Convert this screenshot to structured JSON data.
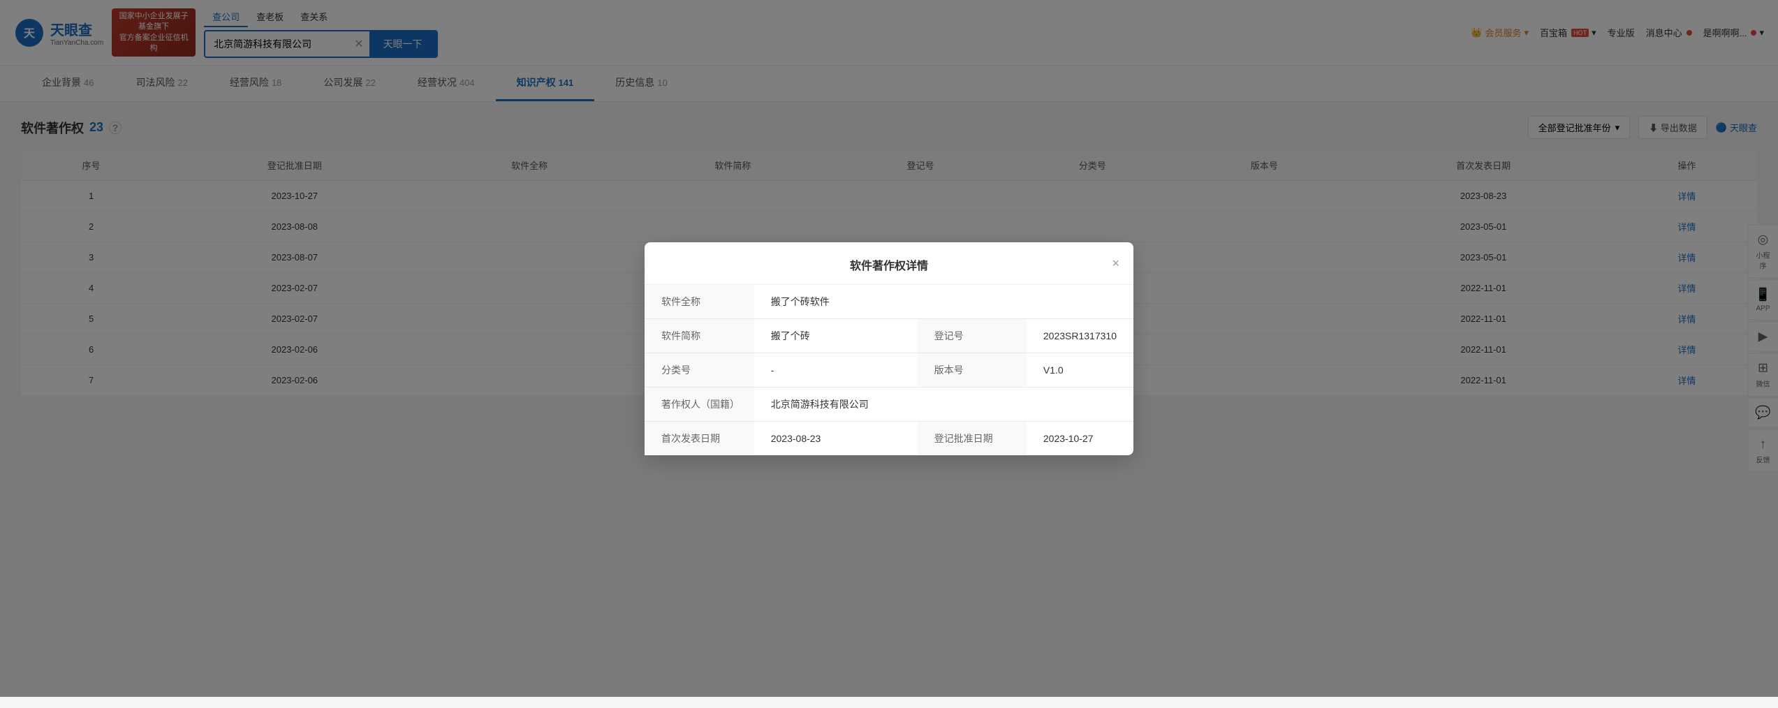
{
  "header": {
    "logo_cn": "天眼查",
    "logo_en": "TianYanCha.com",
    "gov_badge_line1": "国家中小企业发展子基金旗下",
    "gov_badge_line2": "官方备案企业征信机构",
    "search_tabs": [
      {
        "label": "查公司",
        "active": true
      },
      {
        "label": "查老板",
        "active": false
      },
      {
        "label": "查关系",
        "active": false
      }
    ],
    "search_value": "北京简游科技有限公司",
    "search_btn": "天眼一下",
    "nav_right": [
      {
        "label": "会员服务",
        "icon": "crown",
        "type": "member"
      },
      {
        "label": "百宝箱",
        "hot": true
      },
      {
        "label": "专业版"
      },
      {
        "label": "消息中心",
        "dot": true
      },
      {
        "label": "是啊啊啊..."
      }
    ]
  },
  "nav_tabs": [
    {
      "label": "企业背景",
      "count": "46",
      "active": false
    },
    {
      "label": "司法风险",
      "count": "22",
      "active": false
    },
    {
      "label": "经营风险",
      "count": "18",
      "active": false
    },
    {
      "label": "公司发展",
      "count": "22",
      "active": false
    },
    {
      "label": "经营状况",
      "count": "404",
      "active": false
    },
    {
      "label": "知识产权",
      "count": "141",
      "active": true
    },
    {
      "label": "历史信息",
      "count": "10",
      "active": false
    }
  ],
  "section": {
    "title": "软件著作权",
    "count": "23",
    "help_icon": "?",
    "filter_label": "全部登记批准年份",
    "export_label": "导出数据",
    "watermark": "天眼查"
  },
  "table": {
    "columns": [
      "序号",
      "登记批准日期",
      "软件全称",
      "软件简称",
      "登记号",
      "分类号",
      "版本号",
      "首次发表日期",
      "操作"
    ],
    "rows": [
      {
        "id": 1,
        "date": "2023-10-27",
        "full_name": "",
        "short_name": "",
        "reg_no": "",
        "cat_no": "",
        "version": "",
        "pub_date": "2023-08-23",
        "action": "详情"
      },
      {
        "id": 2,
        "date": "2023-08-08",
        "full_name": "",
        "short_name": "",
        "reg_no": "",
        "cat_no": "",
        "version": "",
        "pub_date": "2023-05-01",
        "action": "详情"
      },
      {
        "id": 3,
        "date": "2023-08-07",
        "full_name": "",
        "short_name": "",
        "reg_no": "",
        "cat_no": "",
        "version": "",
        "pub_date": "2023-05-01",
        "action": "详情"
      },
      {
        "id": 4,
        "date": "2023-02-07",
        "full_name": "",
        "short_name": "",
        "reg_no": "",
        "cat_no": "",
        "version": "",
        "pub_date": "2022-11-01",
        "action": "详情"
      },
      {
        "id": 5,
        "date": "2023-02-07",
        "full_name": "",
        "short_name": "",
        "reg_no": "",
        "cat_no": "",
        "version": "",
        "pub_date": "2022-11-01",
        "action": "详情"
      },
      {
        "id": 6,
        "date": "2023-02-06",
        "full_name": "",
        "short_name": "",
        "reg_no": "",
        "cat_no": "",
        "version": "",
        "pub_date": "2022-11-01",
        "action": "详情"
      },
      {
        "id": 7,
        "date": "2023-02-06",
        "full_name": "",
        "short_name": "",
        "reg_no": "",
        "cat_no": "",
        "version": "",
        "pub_date": "2022-11-01",
        "action": "详情"
      }
    ]
  },
  "modal": {
    "title": "软件著作权详情",
    "close_label": "×",
    "fields": [
      {
        "label": "软件全称",
        "value": "搬了个砖软件",
        "span": "full"
      },
      {
        "label": "软件简称",
        "value": "搬了个砖",
        "label2": "登记号",
        "value2": "2023SR1317310"
      },
      {
        "label": "分类号",
        "value": "-",
        "label2": "版本号",
        "value2": "V1.0"
      },
      {
        "label": "著作权人（国籍）",
        "value": "北京简游科技有限公司",
        "span": "full"
      },
      {
        "label": "首次发表日期",
        "value": "2023-08-23",
        "label2": "登记批准日期",
        "value2": "2023-10-27"
      }
    ]
  },
  "floating": {
    "items": [
      {
        "icon": "◎",
        "label": "小程序"
      },
      {
        "icon": "📱",
        "label": "APP"
      },
      {
        "icon": "☰",
        "label": ""
      },
      {
        "icon": "微",
        "label": "微信"
      },
      {
        "icon": "💬",
        "label": ""
      },
      {
        "icon": "↑",
        "label": "反馈"
      }
    ]
  }
}
